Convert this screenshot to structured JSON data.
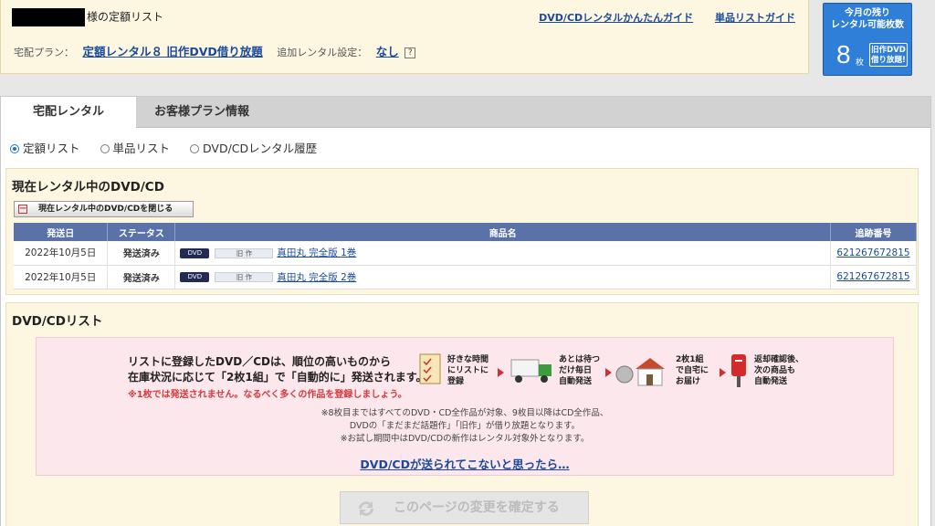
{
  "header": {
    "title_suffix": "様の定額リスト",
    "guide_links": [
      "DVD/CDレンタルかんたんガイド",
      "単品リストガイド"
    ],
    "plan_label": "宅配プラン：",
    "plan_value": "定額レンタル８ 旧作DVD借り放題",
    "additional_label": "追加レンタル設定：",
    "additional_value": "なし",
    "help_icon": "?"
  },
  "remaining": {
    "label_line1": "今月の残り",
    "label_line2": "レンタル可能枚数",
    "count": "8",
    "unit": "枚",
    "badge_line1": "旧作DVD",
    "badge_line2": "借り放題!"
  },
  "tabs": [
    "宅配レンタル",
    "お客様プラン情報"
  ],
  "radios": [
    {
      "label": "定額リスト",
      "checked": true
    },
    {
      "label": "単品リスト",
      "checked": false
    },
    {
      "label": "DVD/CDレンタル履歴",
      "checked": false
    }
  ],
  "rental": {
    "title": "現在レンタル中のDVD/CD",
    "close_button": "現在レンタル中のDVD/CDを閉じる",
    "columns": [
      "発送日",
      "ステータス",
      "商品名",
      "追跡番号"
    ],
    "rows": [
      {
        "date": "2022年10月5日",
        "status": "発送済み",
        "format": "DVD",
        "category": "旧 作",
        "title": "真田丸 完全版 1巻",
        "tracking": "621267672815"
      },
      {
        "date": "2022年10月5日",
        "status": "発送済み",
        "format": "DVD",
        "category": "旧 作",
        "title": "真田丸 完全版 2巻",
        "tracking": "621267672815"
      }
    ]
  },
  "dvdlist": {
    "title": "DVD/CDリスト",
    "banner_line1": "リストに登録したDVD／CDは、順位の高いものから",
    "banner_line2": "在庫状況に応じて「2枚1組」で「自動的に」発送されます。",
    "banner_warning": "※1枚では発送されません。なるべく多くの作品を登録しましょう。",
    "steps": [
      [
        "好きな時間",
        "にリストに",
        "登録"
      ],
      [
        "あとは待つ",
        "だけ毎日",
        "自動発送"
      ],
      [
        "2枚1組",
        "で自宅に",
        "お届け"
      ],
      [
        "返却確認後、",
        "次の商品も",
        "自動発送"
      ]
    ],
    "notes": [
      "※8枚目まではすべてのDVD・CD全作品が対象、9枚目以降はCD全作品、",
      "DVDの「まだまだ話題作」「旧作」が借り放題となります。",
      "※お試し期間中はDVD/CDの新作はレンタル対象外となります。"
    ],
    "help_link": "DVD/CDが送られてこないと思ったら…",
    "confirm_button": "このページの変更を確定する"
  },
  "colors": {
    "accent_blue": "#2f7fd8",
    "table_header": "#5a72a8",
    "panel_bg": "#fdf7e2",
    "banner_bg": "#fbe7ec"
  }
}
